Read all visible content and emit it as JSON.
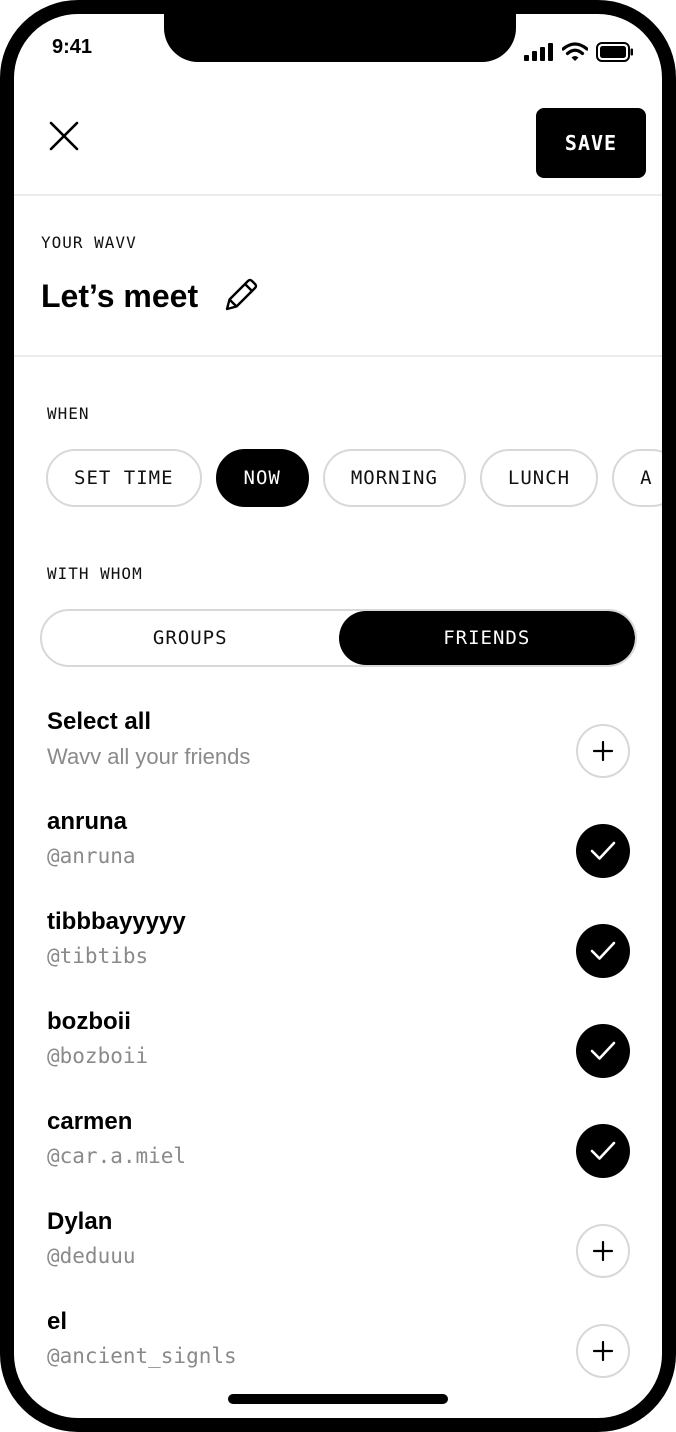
{
  "status_bar": {
    "time": "9:41"
  },
  "header": {
    "close_icon": "close-icon",
    "save_label": "SAVE"
  },
  "wavv": {
    "section_label": "YOUR WAVV",
    "title": "Let’s meet",
    "edit_icon": "pencil-icon"
  },
  "when": {
    "section_label": "WHEN",
    "options": [
      {
        "label": "SET TIME",
        "selected": false
      },
      {
        "label": "NOW",
        "selected": true
      },
      {
        "label": "MORNING",
        "selected": false
      },
      {
        "label": "LUNCH",
        "selected": false
      },
      {
        "label": "A",
        "selected": false
      }
    ]
  },
  "with_whom": {
    "section_label": "WITH WHOM",
    "tabs": [
      {
        "label": "GROUPS",
        "selected": false
      },
      {
        "label": "FRIENDS",
        "selected": true
      }
    ]
  },
  "friends": {
    "select_all": {
      "title": "Select all",
      "subtitle": "Wavv all your friends",
      "selected": false
    },
    "items": [
      {
        "name": "anruna",
        "handle": "@anruna",
        "selected": true
      },
      {
        "name": "tibbbayyyyy",
        "handle": "@tibtibs",
        "selected": true
      },
      {
        "name": "bozboii",
        "handle": "@bozboii",
        "selected": true
      },
      {
        "name": "carmen",
        "handle": "@car.a.miel",
        "selected": true
      },
      {
        "name": "Dylan",
        "handle": "@deduuu",
        "selected": false
      },
      {
        "name": "el",
        "handle": "@ancient_signls",
        "selected": false
      }
    ]
  },
  "colors": {
    "accent": "#000000",
    "border": "#d8d8d8",
    "muted_text": "#8a8a8a",
    "divider": "#ececec"
  }
}
